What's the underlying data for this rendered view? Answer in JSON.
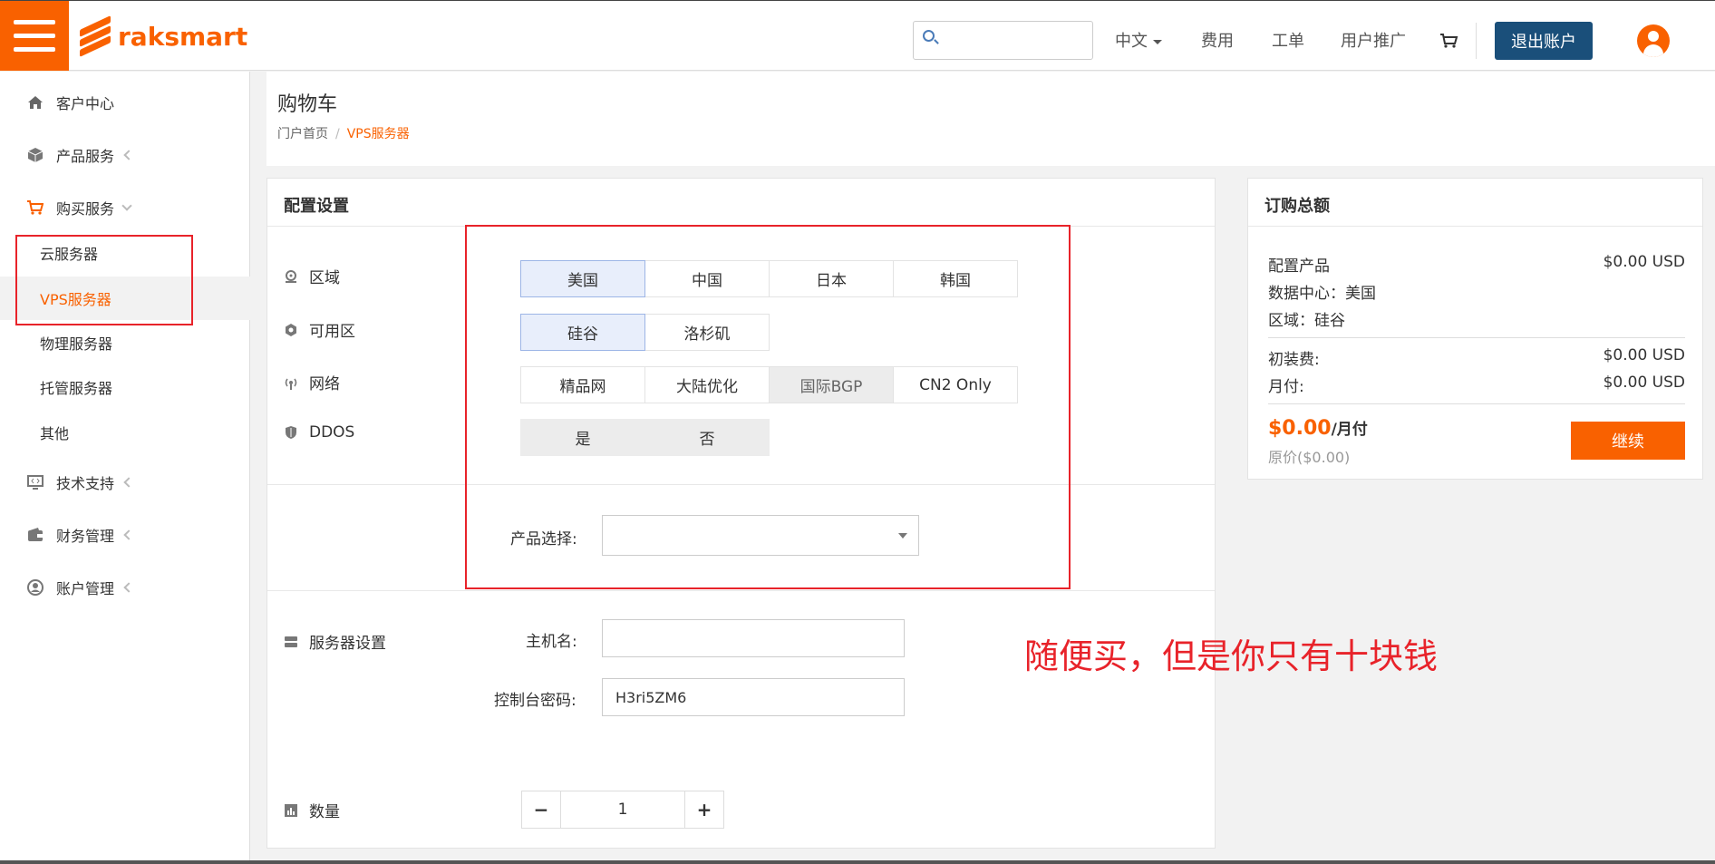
{
  "brand": {
    "name": "raksmart",
    "color": "#f96100"
  },
  "header": {
    "search_placeholder": "",
    "language": "中文",
    "links": [
      "费用",
      "工单",
      "用户推广"
    ],
    "logout": "退出账户"
  },
  "sidebar": {
    "items": [
      {
        "label": "客户中心",
        "icon": "home-icon"
      },
      {
        "label": "产品服务",
        "icon": "box-icon"
      },
      {
        "label": "购买服务",
        "icon": "cart-icon"
      },
      {
        "label": "技术支持",
        "icon": "code-icon"
      },
      {
        "label": "财务管理",
        "icon": "wallet-icon"
      },
      {
        "label": "账户管理",
        "icon": "user-circle-icon"
      }
    ],
    "sub_items": [
      "云服务器",
      "VPS服务器",
      "物理服务器",
      "托管服务器",
      "其他"
    ]
  },
  "page": {
    "title": "购物车",
    "breadcrumb_home": "门户首页",
    "breadcrumb_sep": "/",
    "breadcrumb_current": "VPS服务器"
  },
  "config": {
    "title": "配置设置",
    "region_label": "区域",
    "regions": [
      "美国",
      "中国",
      "日本",
      "韩国"
    ],
    "zone_label": "可用区",
    "zones": [
      "硅谷",
      "洛杉矶"
    ],
    "network_label": "网络",
    "networks": [
      "精品网",
      "大陆优化",
      "国际BGP",
      "CN2 Only"
    ],
    "ddos_label": "DDOS",
    "ddos_options": [
      "是",
      "否"
    ],
    "product_label": "产品选择:",
    "server_settings_label": "服务器设置",
    "hostname_label": "主机名:",
    "hostname_value": "",
    "password_label": "控制台密码:",
    "password_value": "H3ri5ZM6",
    "quantity_label": "数量",
    "quantity_value": "1",
    "minus": "−",
    "plus": "+"
  },
  "annotation": "随便买，但是你只有十块钱",
  "summary": {
    "title": "订购总额",
    "product_label": "配置产品",
    "product_price": "$0.00 USD",
    "datacenter": "数据中心：美国",
    "region": "区域：硅谷",
    "setup_label": "初装费:",
    "setup_price": "$0.00 USD",
    "monthly_label": "月付:",
    "monthly_price": "$0.00 USD",
    "total": "$0.00",
    "total_unit": "/月付",
    "original": "原价($0.00)",
    "continue": "继续"
  }
}
